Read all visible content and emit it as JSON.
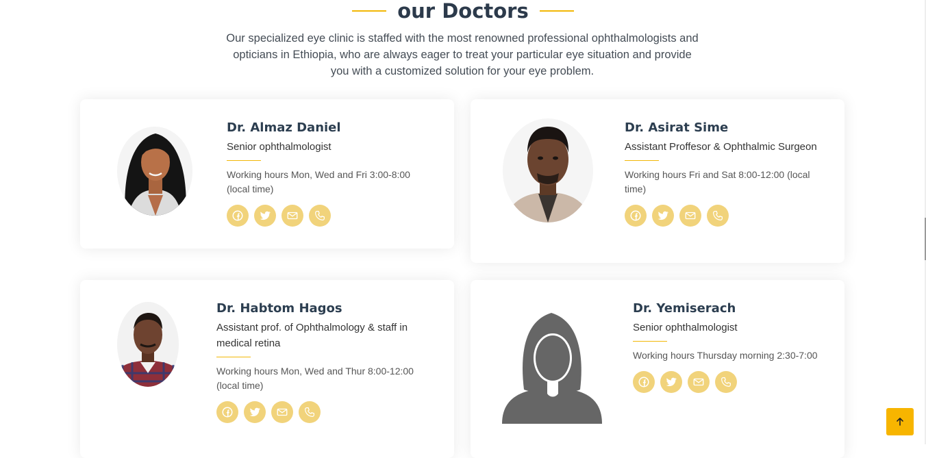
{
  "section": {
    "title": "our Doctors",
    "intro": "Our specialized eye clinic is staffed with the most renowned professional ophthalmologists and opticians in Ethiopia, who are always eager to treat your particular eye situation and provide you with a customized solution for your eye problem."
  },
  "doctors": [
    {
      "name": "Dr. Almaz Daniel",
      "role": "Senior ophthalmologist",
      "hours": "Working hours Mon, Wed and Fri 3:00-8:00 (local time)"
    },
    {
      "name": "Dr. Asirat Sime",
      "role": "Assistant Proffesor & Ophthalmic Surgeon",
      "hours": "Working hours Fri and Sat 8:00-12:00 (local time)"
    },
    {
      "name": "Dr. Habtom Hagos",
      "role": "Assistant prof. of Ophthalmology & staff in medical retina",
      "hours": "Working hours Mon, Wed and Thur 8:00-12:00 (local time)"
    },
    {
      "name": "Dr. Yemiserach",
      "role": "Senior ophthalmologist",
      "hours": "Working hours Thursday morning 2:30-7:00"
    }
  ],
  "social_icons": [
    "facebook-icon",
    "twitter-icon",
    "envelope-icon",
    "phone-icon"
  ],
  "back_to_top": {
    "icon": "arrow-up-icon"
  },
  "colors": {
    "accent": "#f2b705",
    "social_bg": "#f1d37b",
    "heading": "#2c3e50",
    "back_to_top_bg": "#f7b500"
  }
}
